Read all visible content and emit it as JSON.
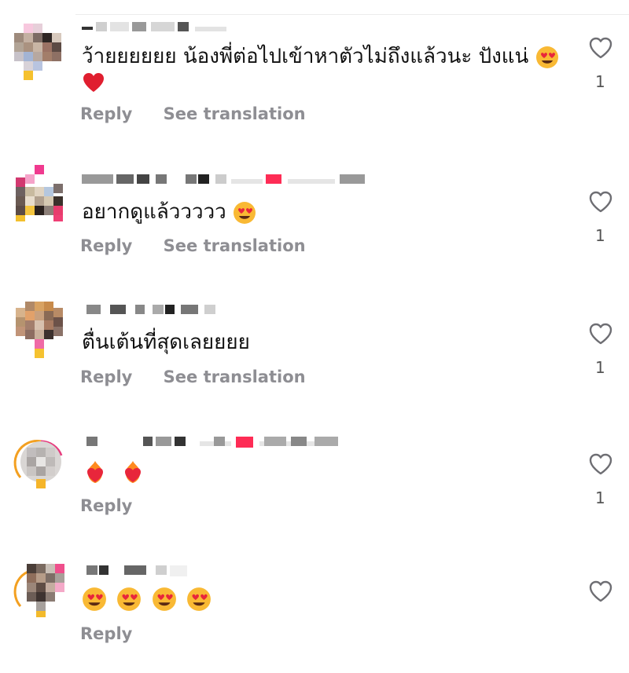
{
  "comments": [
    {
      "text": "ว้ายยยยยย น้องพี่ต่อไปเข้าหาตัวไม่ถึงแล้วนะ ปังแน่",
      "emojis": [
        "heart-eyes-emoji",
        "red-heart-emoji"
      ],
      "reply_label": "Reply",
      "translate_label": "See translation",
      "like_count": "1"
    },
    {
      "text": "อยากดูแล้ววววว",
      "emojis": [
        "heart-eyes-emoji"
      ],
      "reply_label": "Reply",
      "translate_label": "See translation",
      "like_count": "1"
    },
    {
      "text": "ตื่นเต้นที่สุดเลยยยย",
      "emojis": [],
      "reply_label": "Reply",
      "translate_label": "See translation",
      "like_count": "1"
    },
    {
      "text": "",
      "emojis": [
        "heart-on-fire-emoji",
        "heart-on-fire-emoji"
      ],
      "reply_label": "Reply",
      "like_count": "1"
    },
    {
      "text": "",
      "emojis": [
        "heart-eyes-emoji",
        "heart-eyes-emoji",
        "heart-eyes-emoji",
        "heart-eyes-emoji"
      ],
      "reply_label": "Reply",
      "like_count": ""
    }
  ],
  "colors": {
    "secondary_text": "#8e8e93",
    "author_badge": "#fe2c55"
  },
  "icons": {
    "like": "heart-outline-icon"
  }
}
